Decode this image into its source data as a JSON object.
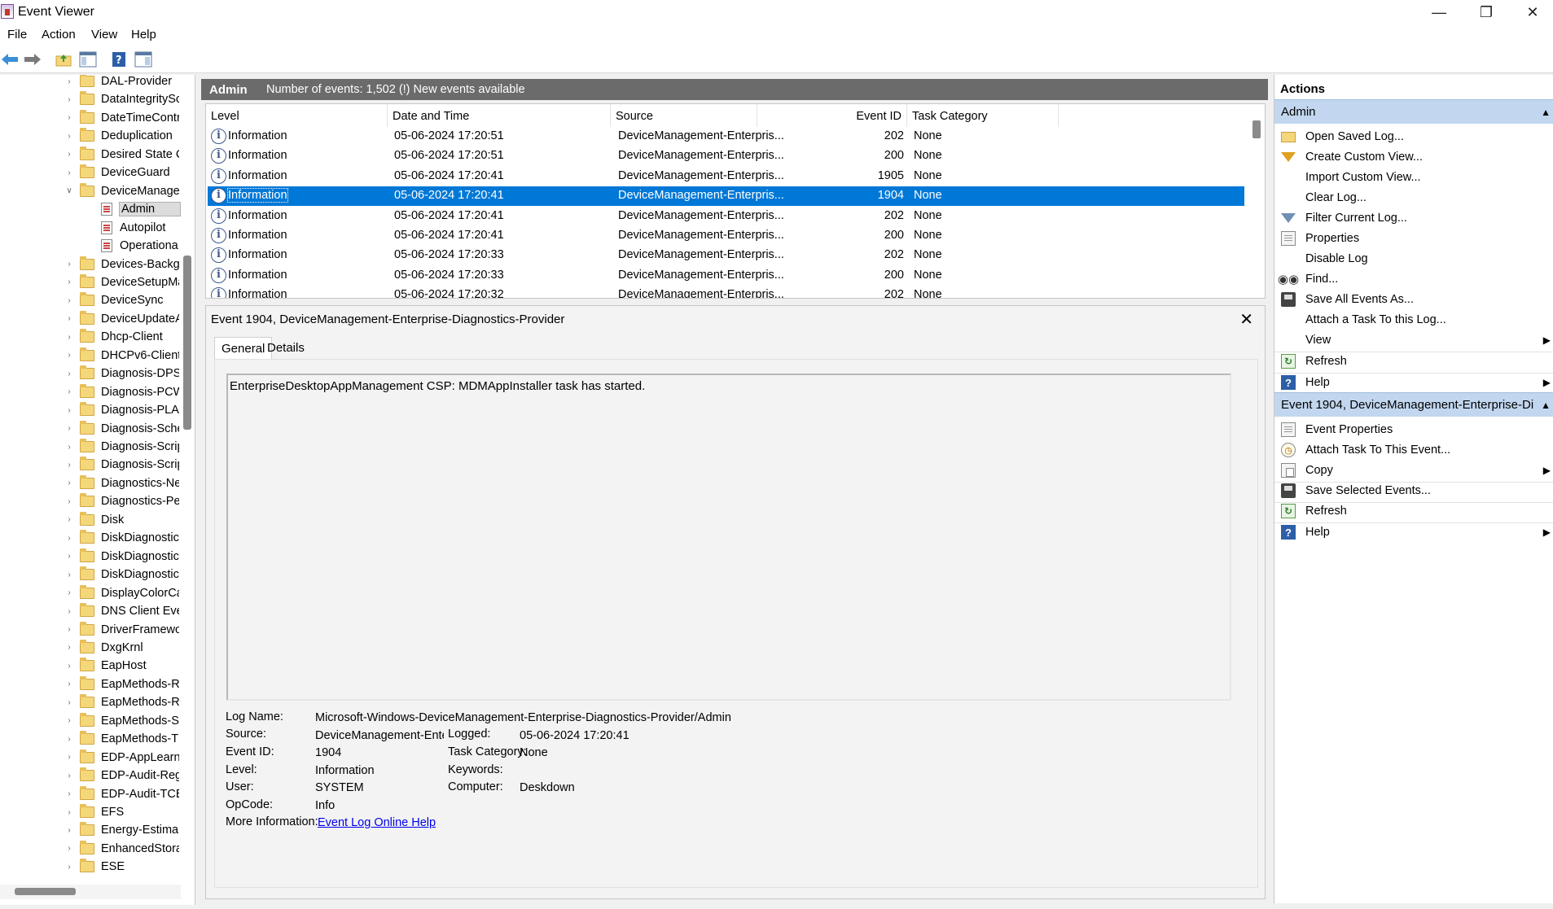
{
  "window": {
    "title": "Event Viewer"
  },
  "menu": [
    "File",
    "Action",
    "View",
    "Help"
  ],
  "tree": {
    "items": [
      {
        "label": "DAL-Provider",
        "expanded": false
      },
      {
        "label": "DataIntegritySc",
        "expanded": false
      },
      {
        "label": "DateTimeContr",
        "expanded": false
      },
      {
        "label": "Deduplication",
        "expanded": false
      },
      {
        "label": "Desired State C",
        "expanded": false
      },
      {
        "label": "DeviceGuard",
        "expanded": false
      },
      {
        "label": "DeviceManage",
        "expanded": true
      },
      {
        "label": "Admin",
        "child": true,
        "selected": true
      },
      {
        "label": "Autopilot",
        "child": true
      },
      {
        "label": "Operationa",
        "child": true
      },
      {
        "label": "Devices-Backg",
        "expanded": false
      },
      {
        "label": "DeviceSetupMa",
        "expanded": false
      },
      {
        "label": "DeviceSync",
        "expanded": false
      },
      {
        "label": "DeviceUpdateA",
        "expanded": false
      },
      {
        "label": "Dhcp-Client",
        "expanded": false
      },
      {
        "label": "DHCPv6-Client",
        "expanded": false
      },
      {
        "label": "Diagnosis-DPS",
        "expanded": false
      },
      {
        "label": "Diagnosis-PCW",
        "expanded": false
      },
      {
        "label": "Diagnosis-PLA",
        "expanded": false
      },
      {
        "label": "Diagnosis-Sche",
        "expanded": false
      },
      {
        "label": "Diagnosis-Scrip",
        "expanded": false
      },
      {
        "label": "Diagnosis-Scrip",
        "expanded": false
      },
      {
        "label": "Diagnostics-Ne",
        "expanded": false
      },
      {
        "label": "Diagnostics-Pe",
        "expanded": false
      },
      {
        "label": "Disk",
        "expanded": false
      },
      {
        "label": "DiskDiagnostic",
        "expanded": false
      },
      {
        "label": "DiskDiagnostic",
        "expanded": false
      },
      {
        "label": "DiskDiagnostic",
        "expanded": false
      },
      {
        "label": "DisplayColorCa",
        "expanded": false
      },
      {
        "label": "DNS Client Eve",
        "expanded": false
      },
      {
        "label": "DriverFramewo",
        "expanded": false
      },
      {
        "label": "DxgKrnl",
        "expanded": false
      },
      {
        "label": "EapHost",
        "expanded": false
      },
      {
        "label": "EapMethods-R",
        "expanded": false
      },
      {
        "label": "EapMethods-R",
        "expanded": false
      },
      {
        "label": "EapMethods-S",
        "expanded": false
      },
      {
        "label": "EapMethods-T",
        "expanded": false
      },
      {
        "label": "EDP-AppLearni",
        "expanded": false
      },
      {
        "label": "EDP-Audit-Reg",
        "expanded": false
      },
      {
        "label": "EDP-Audit-TCB",
        "expanded": false
      },
      {
        "label": "EFS",
        "expanded": false
      },
      {
        "label": "Energy-Estima",
        "expanded": false
      },
      {
        "label": "EnhancedStora",
        "expanded": false
      },
      {
        "label": "ESE",
        "expanded": false
      }
    ]
  },
  "list_header": {
    "title": "Admin",
    "info": "Number of events: 1,502 (!) New events available"
  },
  "columns": [
    "Level",
    "Date and Time",
    "Source",
    "Event ID",
    "Task Category"
  ],
  "events": [
    {
      "level": "Information",
      "datetime": "05-06-2024 17:20:51",
      "source": "DeviceManagement-Enterpris...",
      "id": "202",
      "category": "None"
    },
    {
      "level": "Information",
      "datetime": "05-06-2024 17:20:51",
      "source": "DeviceManagement-Enterpris...",
      "id": "200",
      "category": "None"
    },
    {
      "level": "Information",
      "datetime": "05-06-2024 17:20:41",
      "source": "DeviceManagement-Enterpris...",
      "id": "1905",
      "category": "None"
    },
    {
      "level": "Information",
      "datetime": "05-06-2024 17:20:41",
      "source": "DeviceManagement-Enterpris...",
      "id": "1904",
      "category": "None",
      "selected": true
    },
    {
      "level": "Information",
      "datetime": "05-06-2024 17:20:41",
      "source": "DeviceManagement-Enterpris...",
      "id": "202",
      "category": "None"
    },
    {
      "level": "Information",
      "datetime": "05-06-2024 17:20:41",
      "source": "DeviceManagement-Enterpris...",
      "id": "200",
      "category": "None"
    },
    {
      "level": "Information",
      "datetime": "05-06-2024 17:20:33",
      "source": "DeviceManagement-Enterpris...",
      "id": "202",
      "category": "None"
    },
    {
      "level": "Information",
      "datetime": "05-06-2024 17:20:33",
      "source": "DeviceManagement-Enterpris...",
      "id": "200",
      "category": "None"
    },
    {
      "level": "Information",
      "datetime": "05-06-2024 17:20:32",
      "source": "DeviceManagement-Enterpris...",
      "id": "202",
      "category": "None"
    }
  ],
  "detail": {
    "title": "Event 1904, DeviceManagement-Enterprise-Diagnostics-Provider",
    "tabs": [
      "General",
      "Details"
    ],
    "description": "EnterpriseDesktopAppManagement CSP: MDMAppInstaller task has started.",
    "labels": {
      "log_name": "Log Name:",
      "source": "Source:",
      "event_id": "Event ID:",
      "level": "Level:",
      "user": "User:",
      "opcode": "OpCode:",
      "more_info": "More Information:",
      "logged": "Logged:",
      "task_category": "Task Category:",
      "keywords": "Keywords:",
      "computer": "Computer:"
    },
    "values": {
      "log_name": "Microsoft-Windows-DeviceManagement-Enterprise-Diagnostics-Provider/Admin",
      "source": "DeviceManagement-Enterpri",
      "event_id": "1904",
      "level": "Information",
      "user": "SYSTEM",
      "opcode": "Info",
      "more_info_link": "Event Log Online Help",
      "logged": "05-06-2024 17:20:41",
      "task_category": "None",
      "keywords": "",
      "computer": "Deskdown"
    }
  },
  "actions": {
    "title": "Actions",
    "sections": [
      {
        "label": "Admin",
        "items": [
          {
            "label": "Open Saved Log...",
            "icon": "folder-open-icon"
          },
          {
            "label": "Create Custom View...",
            "icon": "filter-icon"
          },
          {
            "label": "Import Custom View...",
            "icon": ""
          },
          {
            "label": "Clear Log...",
            "icon": ""
          },
          {
            "label": "Filter Current Log...",
            "icon": "filter-icon"
          },
          {
            "label": "Properties",
            "icon": "properties-icon"
          },
          {
            "label": "Disable Log",
            "icon": ""
          },
          {
            "label": "Find...",
            "icon": "binoculars-icon"
          },
          {
            "label": "Save All Events As...",
            "icon": "save-icon"
          },
          {
            "label": "Attach a Task To this Log...",
            "icon": ""
          },
          {
            "label": "View",
            "icon": "",
            "submenu": true
          },
          {
            "label": "Refresh",
            "icon": "refresh-icon"
          },
          {
            "label": "Help",
            "icon": "help-icon",
            "submenu": true
          }
        ]
      },
      {
        "label": "Event 1904, DeviceManagement-Enterprise-Di...",
        "items": [
          {
            "label": "Event Properties",
            "icon": "properties-icon"
          },
          {
            "label": "Attach Task To This Event...",
            "icon": "task-icon"
          },
          {
            "label": "Copy",
            "icon": "copy-icon",
            "submenu": true
          },
          {
            "label": "Save Selected Events...",
            "icon": "save-icon"
          },
          {
            "label": "Refresh",
            "icon": "refresh-icon"
          },
          {
            "label": "Help",
            "icon": "help-icon",
            "submenu": true
          }
        ]
      }
    ]
  }
}
